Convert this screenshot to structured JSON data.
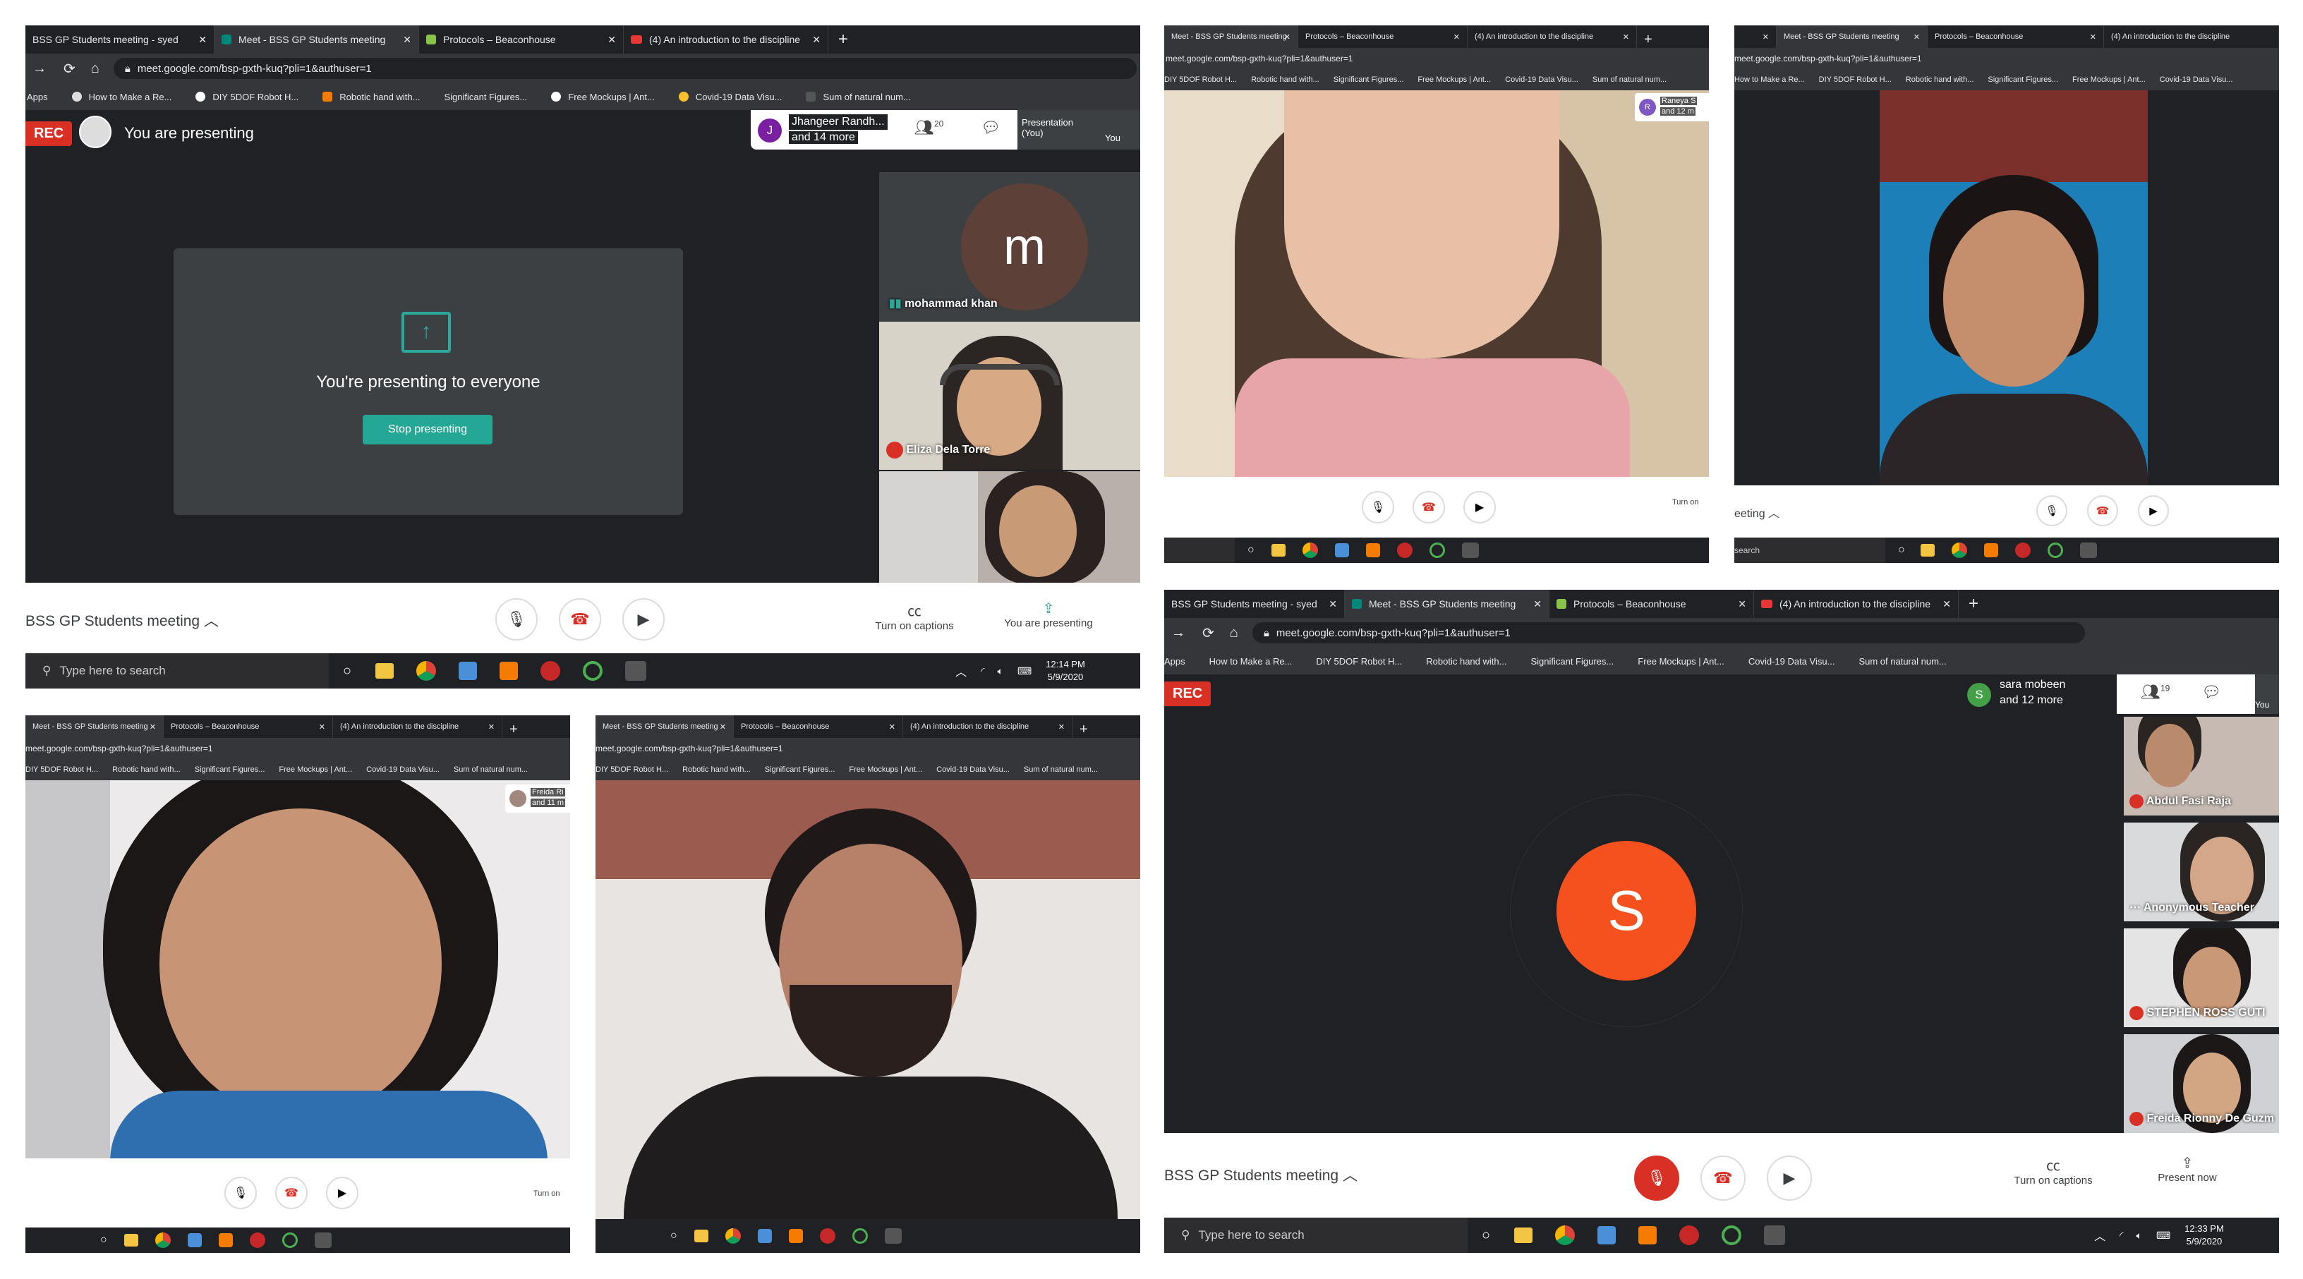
{
  "chrome": {
    "tab_classroom": "BSS GP Students meeting - syed",
    "tab_meet": "Meet - BSS GP Students meeting",
    "tab_protocols": "Protocols – Beaconhouse",
    "tab_youtube": "(4) An introduction to the discipline",
    "url": "meet.google.com/bsp-gxth-kuq?pli=1&authuser=1",
    "apps": "Apps",
    "bookmarks": [
      "How to Make a Re...",
      "DIY 5DOF Robot H...",
      "Robotic hand with...",
      "Significant Figures...",
      "Free Mockups | Ant...",
      "Covid-19 Data Visu...",
      "Sum of natural num..."
    ]
  },
  "meet": {
    "meeting_title": "BSS GP Students meeting",
    "rec": "REC",
    "presenting_banner": "You are presenting",
    "presenting_everyone": "You're presenting to everyone",
    "stop_presenting": "Stop presenting",
    "turn_on_captions": "Turn on captions",
    "you_are_presenting": "You are presenting",
    "present_now": "Present now",
    "turn_on": "Turn on",
    "presentation_you": "Presentation (You)",
    "you": "You"
  },
  "panel1": {
    "host_initial": "J",
    "host_name": "Jhangeer Randh...",
    "host_more": "and 14 more",
    "participants_count": "20",
    "tiles": [
      {
        "initial": "m",
        "name": "mohammad khan"
      },
      {
        "name": "Eliza Dela Torre"
      }
    ]
  },
  "panel2": {
    "initial": "R",
    "name": "Raneya S",
    "more": "and 12 m"
  },
  "panel3": {
    "meeting_fragment": "eeting",
    "search": "search"
  },
  "panel4": {
    "name": "Freida Ri",
    "more": "and 11 m"
  },
  "panel6": {
    "host_initial": "S",
    "host_name": "sara mobeen",
    "host_more": "and 12 more",
    "participants_count": "19",
    "big_initial": "S",
    "tiles": [
      {
        "name": "Abdul Fasi Raja"
      },
      {
        "name": "Anonymous Teacher"
      },
      {
        "name": "STEPHEN ROSS GUTI"
      },
      {
        "name": "Freida Rionny De Guzm"
      }
    ]
  },
  "taskbar": {
    "search_placeholder": "Type here to search",
    "time1": "12:14 PM",
    "date1": "5/9/2020",
    "time2": "12:33 PM",
    "date2": "5/9/2020"
  },
  "colors": {
    "accent_teal": "#2ca89b",
    "stop_btn": "#24a895",
    "rec_red": "#d93025",
    "orange_avatar": "#f4511e"
  }
}
